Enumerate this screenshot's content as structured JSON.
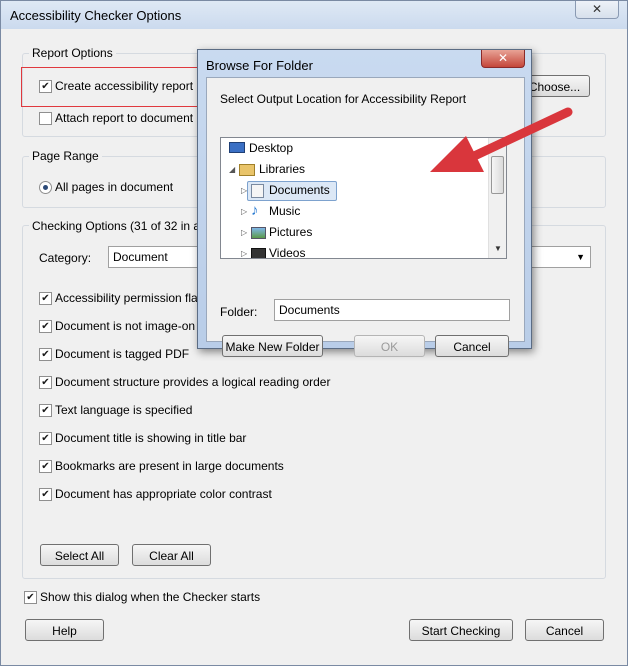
{
  "window": {
    "title": "Accessibility Checker Options",
    "close_glyph": "✕"
  },
  "report_options": {
    "label": "Report Options",
    "create_report": {
      "label": "Create accessibility report",
      "checked": true
    },
    "attach_report": {
      "label": "Attach report to document",
      "checked": false
    },
    "choose_label": "Choose..."
  },
  "page_range": {
    "label": "Page Range",
    "all_pages": "All pages in document"
  },
  "checking_options": {
    "label": "Checking Options (31 of 32 in a",
    "category_label": "Category:",
    "category_value": "Document",
    "items": [
      {
        "label": "Accessibility permission fla",
        "checked": true
      },
      {
        "label": "Document is not image-on",
        "checked": true
      },
      {
        "label": "Document is tagged PDF",
        "checked": true
      },
      {
        "label": "Document structure provides a logical reading order",
        "checked": true
      },
      {
        "label": "Text language is specified",
        "checked": true
      },
      {
        "label": "Document title is showing in title bar",
        "checked": true
      },
      {
        "label": "Bookmarks are present in large documents",
        "checked": true
      },
      {
        "label": "Document has appropriate color contrast",
        "checked": true
      }
    ],
    "select_all": "Select All",
    "clear_all": "Clear All"
  },
  "show_dialog": {
    "label": "Show this dialog when the Checker starts",
    "checked": true
  },
  "footer": {
    "help": "Help",
    "start": "Start Checking",
    "cancel": "Cancel"
  },
  "browse": {
    "title": "Browse For Folder",
    "close_glyph": "✕",
    "instruction": "Select Output Location for Accessibility Report",
    "tree": {
      "desktop": "Desktop",
      "libraries": "Libraries",
      "documents": "Documents",
      "music": "Music",
      "pictures": "Pictures",
      "videos": "Videos"
    },
    "folder_label": "Folder:",
    "folder_value": "Documents",
    "make_new_folder": "Make New Folder",
    "ok": "OK",
    "cancel": "Cancel"
  },
  "colors": {
    "highlight_red": "#e0393e",
    "arrow_red": "#d9363c",
    "dialog_frame": "#b9cde8"
  }
}
